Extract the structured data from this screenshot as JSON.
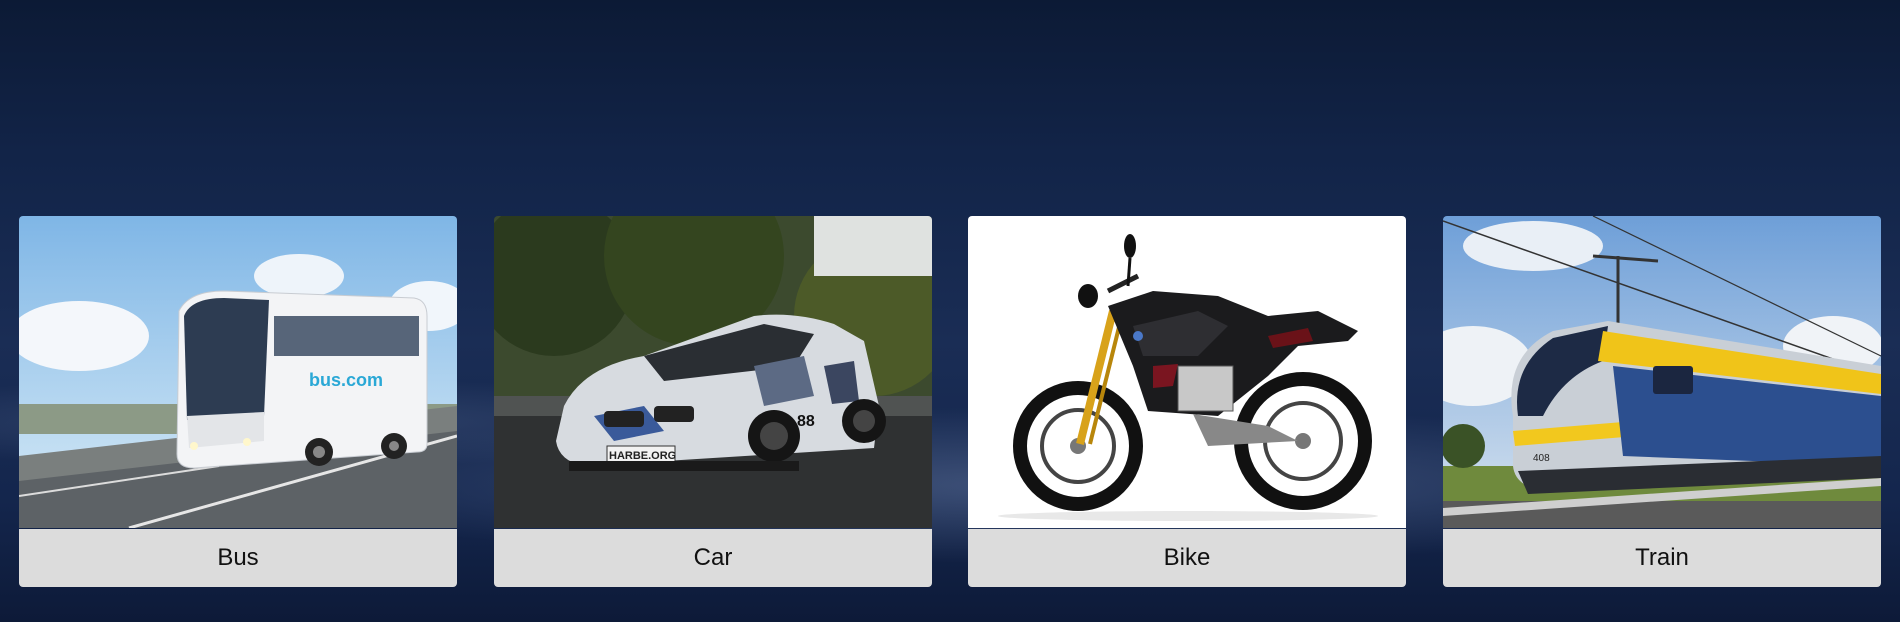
{
  "cards": [
    {
      "label": "Bus",
      "bus_logo": "bus.com"
    },
    {
      "label": "Car",
      "plate": "HARBE.ORG",
      "number": "88"
    },
    {
      "label": "Bike"
    },
    {
      "label": "Train",
      "train_number": "408"
    }
  ],
  "colors": {
    "label_bg": "#dcdcdc",
    "background": "#13244a"
  }
}
